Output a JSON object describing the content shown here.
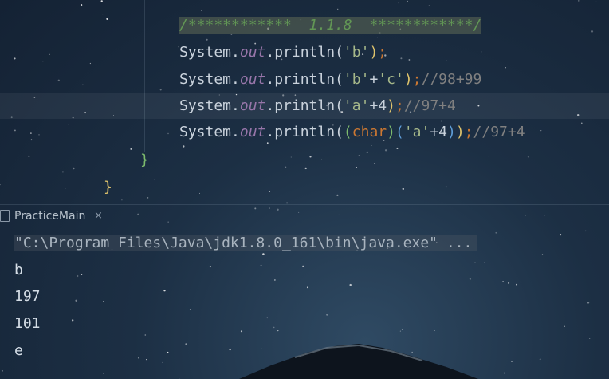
{
  "editor": {
    "lines": [
      {
        "parts": [
          {
            "t": "/************  1.1.8  ************/",
            "c": "comment-green"
          }
        ]
      },
      {
        "parts": [
          {
            "t": "System.",
            "c": ""
          },
          {
            "t": "out",
            "c": "out"
          },
          {
            "t": ".println(",
            "c": ""
          },
          {
            "t": "'b'",
            "c": "str2"
          },
          {
            "t": ")",
            "c": "paren-y"
          },
          {
            "t": ";",
            "c": "semi"
          }
        ]
      },
      {
        "parts": [
          {
            "t": "System.",
            "c": ""
          },
          {
            "t": "out",
            "c": "out"
          },
          {
            "t": ".println(",
            "c": ""
          },
          {
            "t": "'b'",
            "c": "str2"
          },
          {
            "t": "+",
            "c": ""
          },
          {
            "t": "'c'",
            "c": "str2"
          },
          {
            "t": ")",
            "c": "paren-y"
          },
          {
            "t": ";",
            "c": "semi"
          },
          {
            "t": "//98+99",
            "c": "cmt"
          }
        ]
      },
      {
        "parts": [
          {
            "t": "System.",
            "c": ""
          },
          {
            "t": "out",
            "c": "out"
          },
          {
            "t": ".println(",
            "c": ""
          },
          {
            "t": "'a'",
            "c": "str2"
          },
          {
            "t": "+4",
            "c": ""
          },
          {
            "t": ")",
            "c": "paren-y"
          },
          {
            "t": ";",
            "c": "semi"
          },
          {
            "t": "//97+4",
            "c": "cmt"
          }
        ]
      },
      {
        "parts": [
          {
            "t": "System.",
            "c": ""
          },
          {
            "t": "out",
            "c": "out"
          },
          {
            "t": ".println(",
            "c": ""
          },
          {
            "t": "(",
            "c": "paren-g"
          },
          {
            "t": "char",
            "c": "kw"
          },
          {
            "t": ")",
            "c": "paren-g"
          },
          {
            "t": "(",
            "c": "paren-b"
          },
          {
            "t": "'a'",
            "c": "str2"
          },
          {
            "t": "+4",
            "c": ""
          },
          {
            "t": ")",
            "c": "paren-b"
          },
          {
            "t": ")",
            "c": "paren-y"
          },
          {
            "t": ";",
            "c": "semi"
          },
          {
            "t": "//97+4",
            "c": "cmt"
          }
        ]
      }
    ],
    "inner_brace": "}",
    "outer_brace": "}"
  },
  "run_panel": {
    "tab_label": "PracticeMain",
    "close_label": "×"
  },
  "console": {
    "command": "\"C:\\Program Files\\Java\\jdk1.8.0_161\\bin\\java.exe\" ...",
    "output": [
      "b",
      "197",
      "101",
      "e"
    ]
  },
  "colors": {
    "comment_green": "#629755",
    "keyword": "#cc7832",
    "static_field": "#9876aa",
    "line_comment": "#808080",
    "inner_brace": "#7dbb6d",
    "outer_brace": "#e0c46c"
  }
}
